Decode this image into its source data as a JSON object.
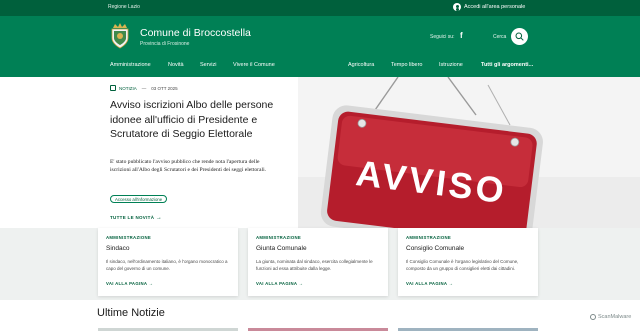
{
  "topbar": {
    "region": "Regione Lazio",
    "login_label": "Accedi all'area personale"
  },
  "header": {
    "brand_name": "Comune di Broccostella",
    "brand_subtitle": "Provincia di Frosinone",
    "social_label": "Seguici su:",
    "social_icon": "facebook-icon",
    "search_label": "Cerca",
    "search_icon": "search-icon"
  },
  "nav": {
    "main": [
      "Amministrazione",
      "Novità",
      "Servizi",
      "Vivere il Comune"
    ],
    "secondary": [
      "Agricoltura",
      "Tempo libero",
      "Istruzione",
      "Tutti gli argomenti..."
    ]
  },
  "hero": {
    "category": "NOTIZIA",
    "date": "03 OTT 2025",
    "title": "Avviso iscrizioni Albo delle persone idonee all'ufficio di Presidente e Scrutatore di Seggio Elettorale",
    "description": "E' stato pubblicato l'avviso pubblico che rende nota l'apertura delle iscrizioni all'Albo degli Scrutatori e dei Presidenti dei seggi elettorali.",
    "tag": "Accesso all'informazione",
    "all_news_link": "TUTTE LE NOVITÀ",
    "sign_text": "AVVISO"
  },
  "cards": [
    {
      "category": "AMMINISTRAZIONE",
      "title": "Sindaco",
      "text": "Il sindaco, nell'ordinamento italiano, è l'organo monocratico a capo del governo di un comune.",
      "link": "VAI ALLA PAGINA"
    },
    {
      "category": "AMMINISTRAZIONE",
      "title": "Giunta Comunale",
      "text": "La giunta, nominata dal sindaco, esercita collegialmente le funzioni ad essa attribuite dalla legge.",
      "link": "VAI ALLA PAGINA"
    },
    {
      "category": "AMMINISTRAZIONE",
      "title": "Consiglio Comunale",
      "text": "Il Consiglio Comunale è l'organo legislativo del Comune, composto da un gruppo di consiglieri eletti dai cittadini.",
      "link": "VAI ALLA PAGINA"
    }
  ],
  "latest_news": {
    "heading": "Ultime Notizie"
  },
  "watermark": "ScanMalware",
  "colors": {
    "brand": "#008055",
    "brand_dark": "#00603c",
    "sign_red": "#c8283a"
  }
}
